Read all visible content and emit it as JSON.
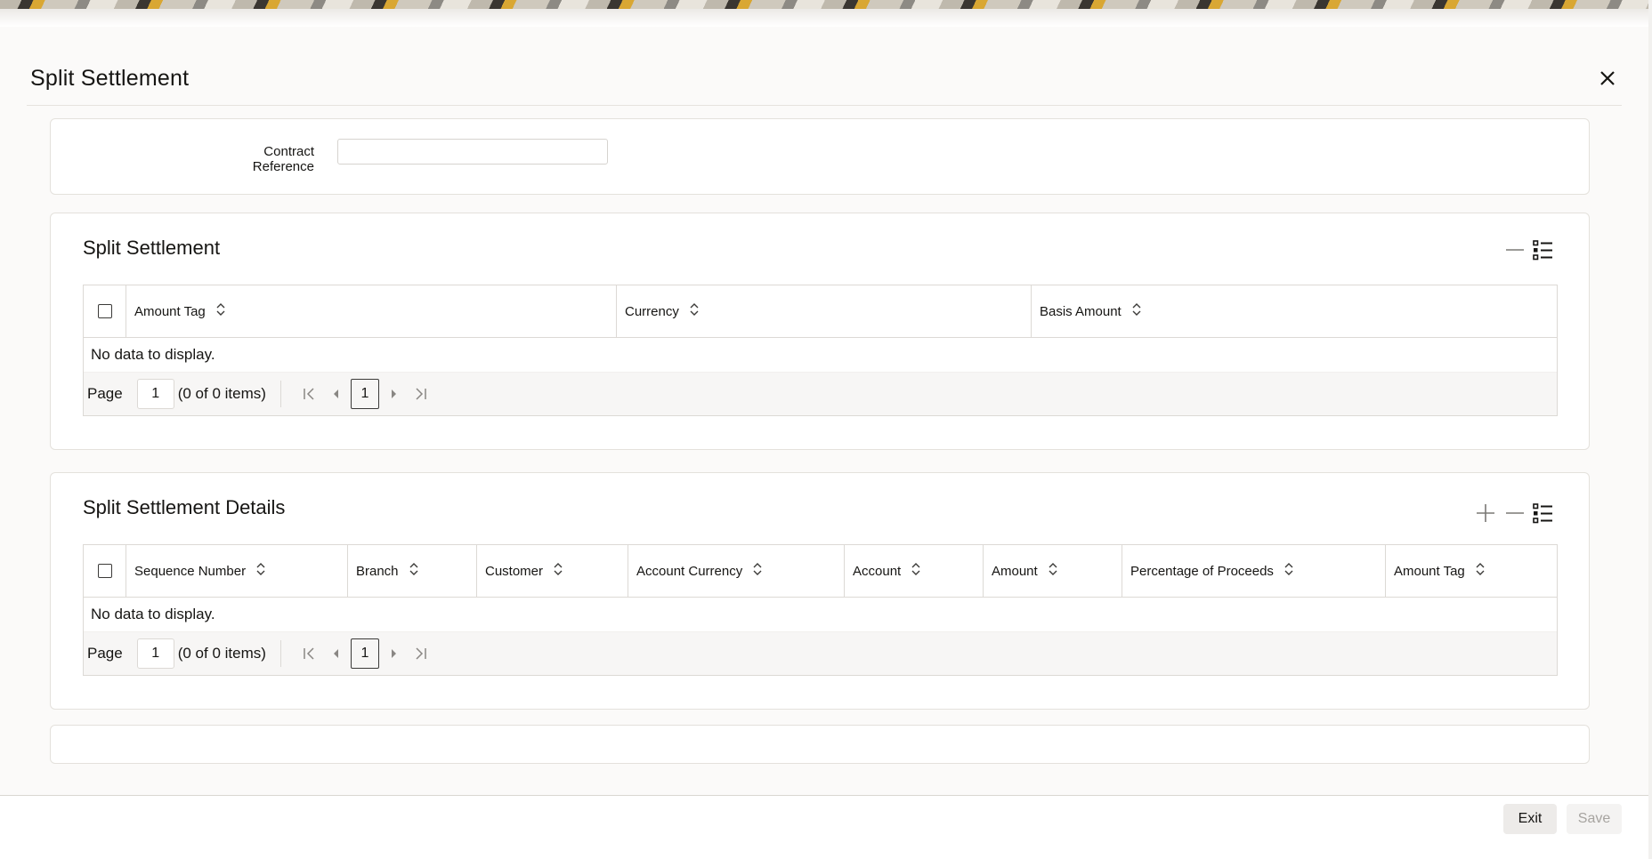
{
  "dialog": {
    "title": "Split Settlement",
    "close_icon": "close-icon"
  },
  "contract": {
    "label": "Contract Reference",
    "value": ""
  },
  "split_settlement": {
    "title": "Split Settlement",
    "columns": [
      "Amount Tag",
      "Currency",
      "Basis Amount"
    ],
    "empty_text": "No data to display.",
    "pager": {
      "page_label": "Page",
      "page_value": "1",
      "items_text": "(0 of 0 items)",
      "current_page": "1"
    }
  },
  "split_details": {
    "title": "Split Settlement Details",
    "columns": [
      "Sequence Number",
      "Branch",
      "Customer",
      "Account Currency",
      "Account",
      "Amount",
      "Percentage of Proceeds",
      "Amount Tag"
    ],
    "empty_text": "No data to display.",
    "pager": {
      "page_label": "Page",
      "page_value": "1",
      "items_text": "(0 of 0 items)",
      "current_page": "1"
    }
  },
  "footer": {
    "exit_label": "Exit",
    "save_label": "Save"
  },
  "colors": {
    "text": "#161513",
    "border": "#dcd9d5",
    "disabled_text": "#a7a4a0"
  }
}
